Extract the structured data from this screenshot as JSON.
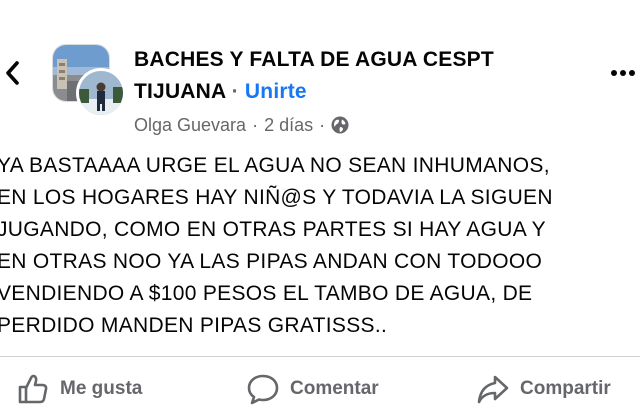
{
  "header": {
    "group_name_line1": "BACHES Y FALTA DE AGUA CESPT",
    "group_name_line2": "TIJUANA",
    "separator": "·",
    "join_label": "Unirte"
  },
  "post": {
    "author": "Olga Guevara",
    "time": "2 días",
    "separator": "·",
    "audience_icon": "globe-icon",
    "lines": [
      "YA BASTAAAA URGE EL AGUA NO SEAN INHUMANOS,",
      "EN LOS HOGARES HAY NIÑ@S Y TODAVIA LA SIGUEN",
      "JUGANDO, COMO EN OTRAS PARTES SI HAY AGUA Y",
      "EN OTRAS NOO YA LAS PIPAS ANDAN CON TODOOO",
      "VENDIENDO A $100 PESOS EL TAMBO DE AGUA, DE",
      "PERDIDO MANDEN PIPAS GRATISSS.."
    ]
  },
  "actions": {
    "like": "Me gusta",
    "comment": "Comentar",
    "share": "Compartir"
  },
  "colors": {
    "link": "#1877f2",
    "secondary_text": "#65676b",
    "primary_text": "#050505",
    "divider": "#ced0d4"
  },
  "icons": [
    "chevron-left-icon",
    "more-icon",
    "globe-icon",
    "thumbs-up-icon",
    "comment-icon",
    "share-icon"
  ]
}
